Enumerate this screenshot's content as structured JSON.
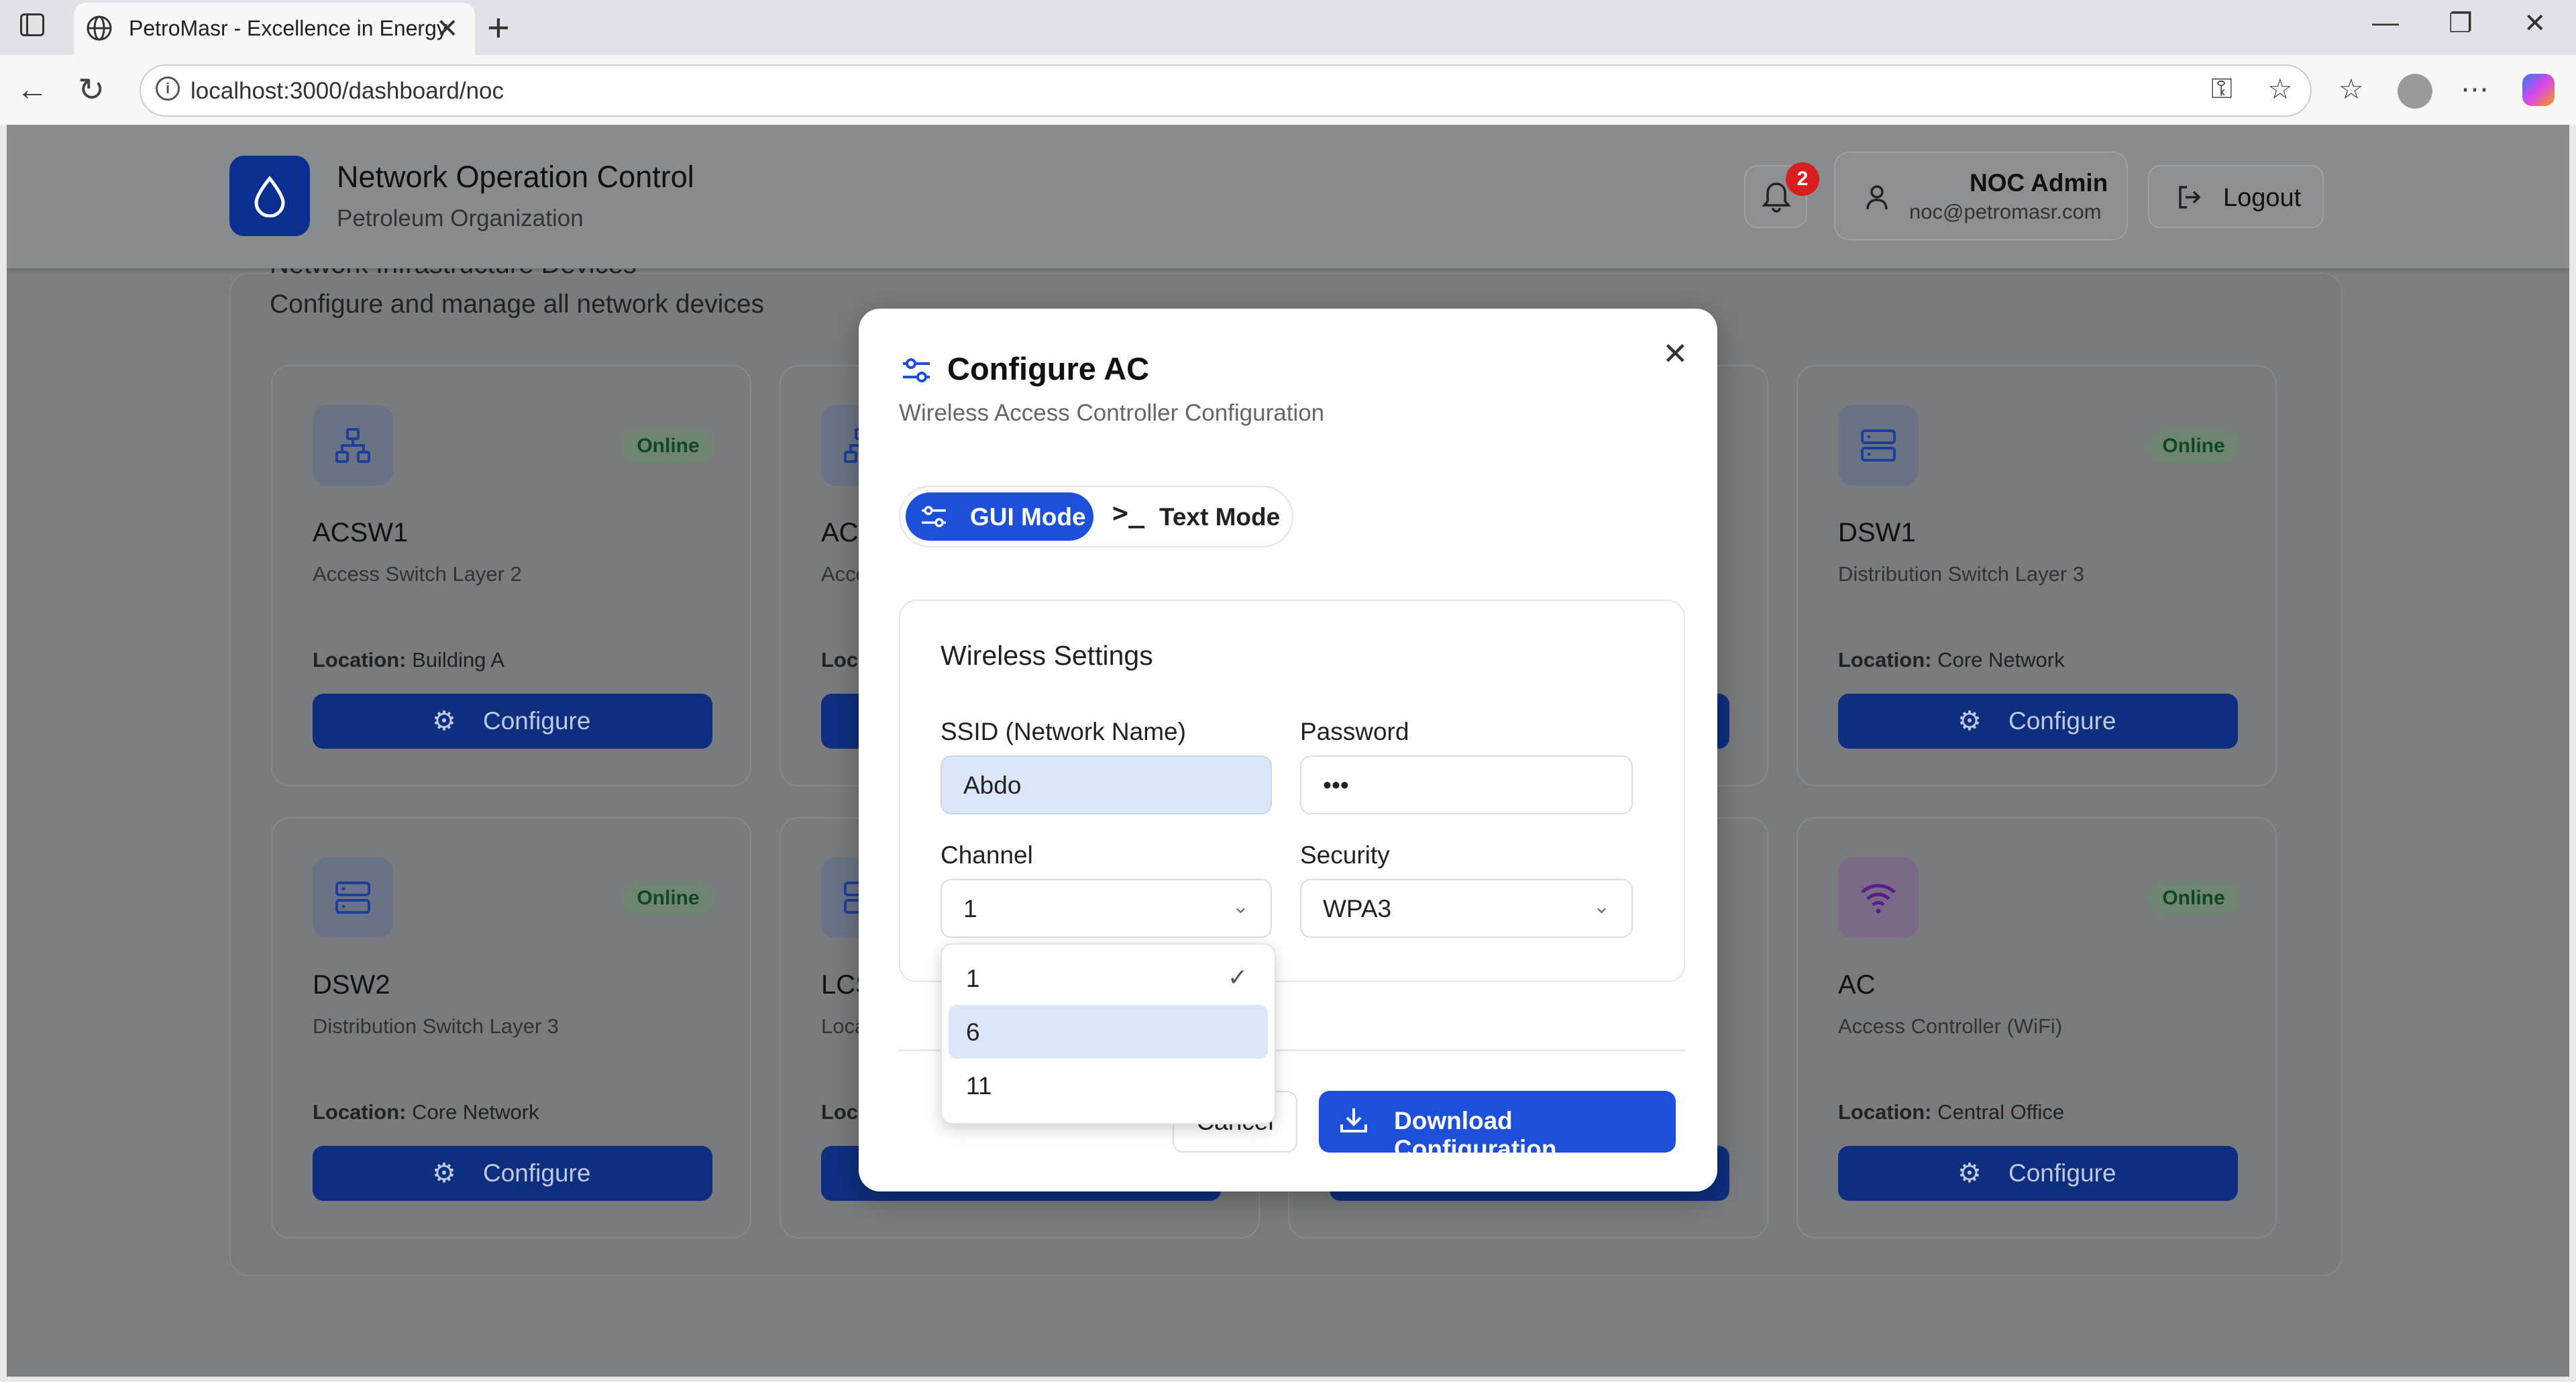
{
  "browser": {
    "tab_title": "PetroMasr - Excellence in Energy",
    "url": "localhost:3000/dashboard/noc"
  },
  "header": {
    "title": "Network Operation Control",
    "subtitle": "Petroleum Organization",
    "notification_count": "2",
    "user_name": "NOC Admin",
    "user_email": "noc@petromasr.com",
    "logout_label": "Logout"
  },
  "section": {
    "title": "Network Infrastructure Devices",
    "subtitle": "Configure and manage all network devices"
  },
  "devices": [
    {
      "name": "ACSW1",
      "desc": "Access Switch Layer 2",
      "location_label": "Location:",
      "location": "Building A",
      "status": "Online",
      "icon": "network-icon",
      "configure_label": "Configure"
    },
    {
      "name": "ACS",
      "desc": "Acce",
      "location_label": "Loca",
      "location": "",
      "status": "",
      "icon": "network-icon",
      "configure_label": ""
    },
    {
      "name": "DSW1",
      "desc": "Distribution Switch Layer 3",
      "location_label": "Location:",
      "location": "Core Network",
      "status": "Online",
      "icon": "server-icon",
      "configure_label": "Configure"
    },
    {
      "name": "DSW2",
      "desc": "Distribution Switch Layer 3",
      "location_label": "Location:",
      "location": "Core Network",
      "status": "Online",
      "icon": "server-icon",
      "configure_label": "Configure"
    },
    {
      "name": "LCS",
      "desc": "Loca",
      "location_label": "Loca",
      "location": "",
      "status": "",
      "icon": "server-icon",
      "configure_label": ""
    },
    {
      "name": "AC",
      "desc": "Access Controller (WiFi)",
      "location_label": "Location:",
      "location": "Central Office",
      "status": "Online",
      "icon": "wifi-icon",
      "configure_label": "Configure"
    }
  ],
  "modal": {
    "title": "Configure AC",
    "subtitle": "Wireless Access Controller Configuration",
    "gui_mode_label": "GUI Mode",
    "text_mode_label": "Text Mode",
    "section_title": "Wireless Settings",
    "ssid_label": "SSID (Network Name)",
    "ssid_value": "Abdo",
    "password_label": "Password",
    "password_value": "•••",
    "channel_label": "Channel",
    "channel_value": "1",
    "security_label": "Security",
    "security_value": "WPA3",
    "cancel_label": "Cancel",
    "download_label": "Download Configuration"
  },
  "channel_dropdown": {
    "options": [
      "1",
      "6",
      "11"
    ],
    "selected": "1",
    "highlighted": "6"
  },
  "colors": {
    "primary": "#1d4fd8",
    "brand_dark": "#0a2f91",
    "online_badge": "#6f8571",
    "notification": "#d81e1e"
  }
}
